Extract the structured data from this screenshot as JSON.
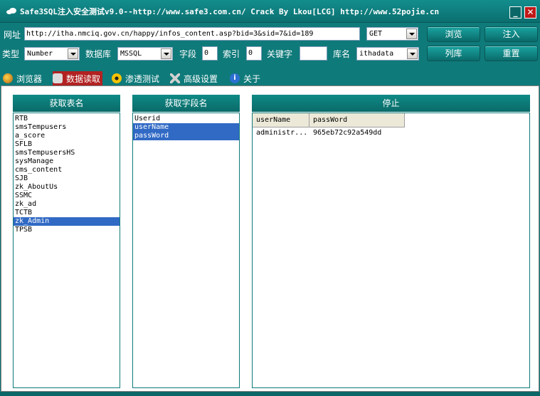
{
  "window": {
    "title": "Safe3SQL注入安全测试v9.0--http://www.safe3.com.cn/  Crack By Lkou[LCG]  http://www.52pojie.cn",
    "minimize": "_",
    "close": "✕"
  },
  "toolbar": {
    "url_label": "网址",
    "url_value": "http://itha.nmciq.gov.cn/happy/infos_content.asp?bid=3&sid=7&id=189",
    "method_value": "GET",
    "browse_button": "浏览",
    "inject_button": "注入",
    "type_label": "类型",
    "type_value": "Number",
    "database_label": "数据库",
    "database_value": "MSSQL",
    "field_label": "字段",
    "field_value": "0",
    "index_label": "索引",
    "index_value": "0",
    "keyword_label": "关键字",
    "keyword_value": "",
    "dbname_label": "库名",
    "dbname_value": "ithadata",
    "list_db_button": "列库",
    "reset_button": "重置"
  },
  "tabs": [
    {
      "label": "浏览器",
      "icon": "browser-icon",
      "active": false
    },
    {
      "label": "数据读取",
      "icon": "database-icon",
      "active": true
    },
    {
      "label": "渗透测试",
      "icon": "radiation-icon",
      "active": false
    },
    {
      "label": "高级设置",
      "icon": "tools-icon",
      "active": false
    },
    {
      "label": "关于",
      "icon": "info-icon",
      "active": false
    }
  ],
  "tables_panel": {
    "header": "获取表名",
    "items": [
      "RTB",
      "smsTempusers",
      "a_score",
      "SFLB",
      "smsTempusersHS",
      "sysManage",
      "cms_content",
      "SJB",
      "zk_AboutUs",
      "SSMC",
      "zk_ad",
      "TCTB",
      "zk_Admin",
      "TPSB"
    ],
    "selected_index": 12
  },
  "fields_panel": {
    "header": "获取字段名",
    "items": [
      "Userid",
      "userName",
      "passWord"
    ],
    "selected_indices": [
      1,
      2
    ]
  },
  "results_panel": {
    "header": "停止",
    "columns": [
      "userName",
      "passWord"
    ],
    "rows": [
      [
        "administr...",
        "965eb72c92a549dd"
      ]
    ]
  },
  "colors": {
    "frame": "#0f7a7a",
    "selection": "#316ac5",
    "active_tab": "#b22222"
  }
}
